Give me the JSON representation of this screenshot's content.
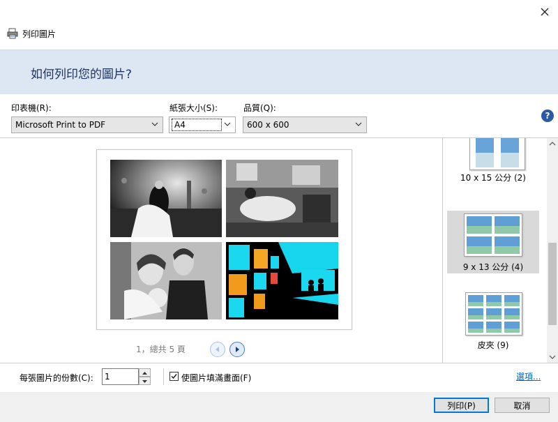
{
  "window": {
    "title": "列印圖片"
  },
  "header": {
    "question": "如何列印您的圖片?"
  },
  "controls": {
    "printer": {
      "label": "印表機(R):",
      "value": "Microsoft Print to PDF"
    },
    "paper_size": {
      "label": "紙張大小(S):",
      "value": "A4"
    },
    "quality": {
      "label": "品質(Q):",
      "value": "600 x 600"
    }
  },
  "preview": {
    "page_indicator": "1，總共 5 頁"
  },
  "layouts": [
    {
      "label": "10 x 15 公分 (2)",
      "selected": false
    },
    {
      "label": "9 x 13 公分 (4)",
      "selected": true
    },
    {
      "label": "皮夾 (9)",
      "selected": false
    }
  ],
  "options": {
    "copies_label": "每張圖片的份數(C):",
    "copies_value": "1",
    "fit_label": "使圖片填滿畫面(F)",
    "fit_checked": true,
    "options_link": "選項..."
  },
  "buttons": {
    "print": "列印(P)",
    "cancel": "取消"
  },
  "colors": {
    "header_band": "#dde6f3",
    "accent": "#0078d7",
    "link": "#0066cc",
    "selected_layout": "#d9d9d9"
  }
}
